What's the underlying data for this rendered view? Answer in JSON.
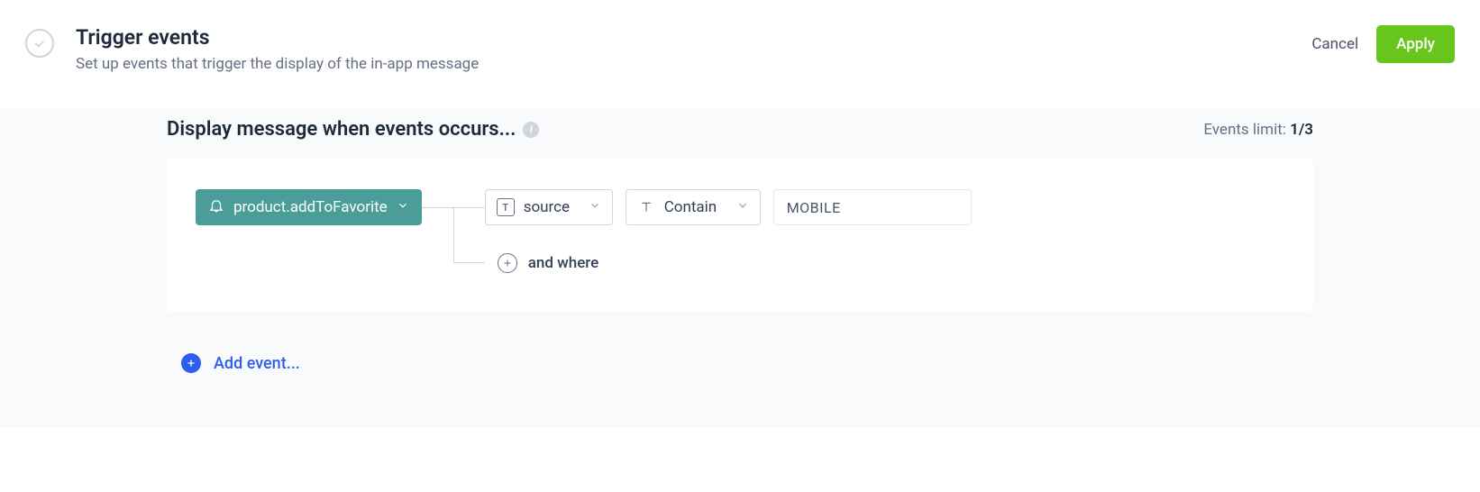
{
  "header": {
    "title": "Trigger events",
    "subtitle": "Set up events that trigger the display of the in-app message",
    "cancel_label": "Cancel",
    "apply_label": "Apply"
  },
  "section": {
    "title": "Display message when events occurs...",
    "events_limit_label": "Events limit: ",
    "events_limit_current": "1",
    "events_limit_total": "/3"
  },
  "event": {
    "name": "product.addToFavorite",
    "filter": {
      "attribute": "source",
      "operator": "Contain",
      "value": "MOBILE"
    },
    "and_where_label": "and where"
  },
  "add_event_label": "Add event..."
}
